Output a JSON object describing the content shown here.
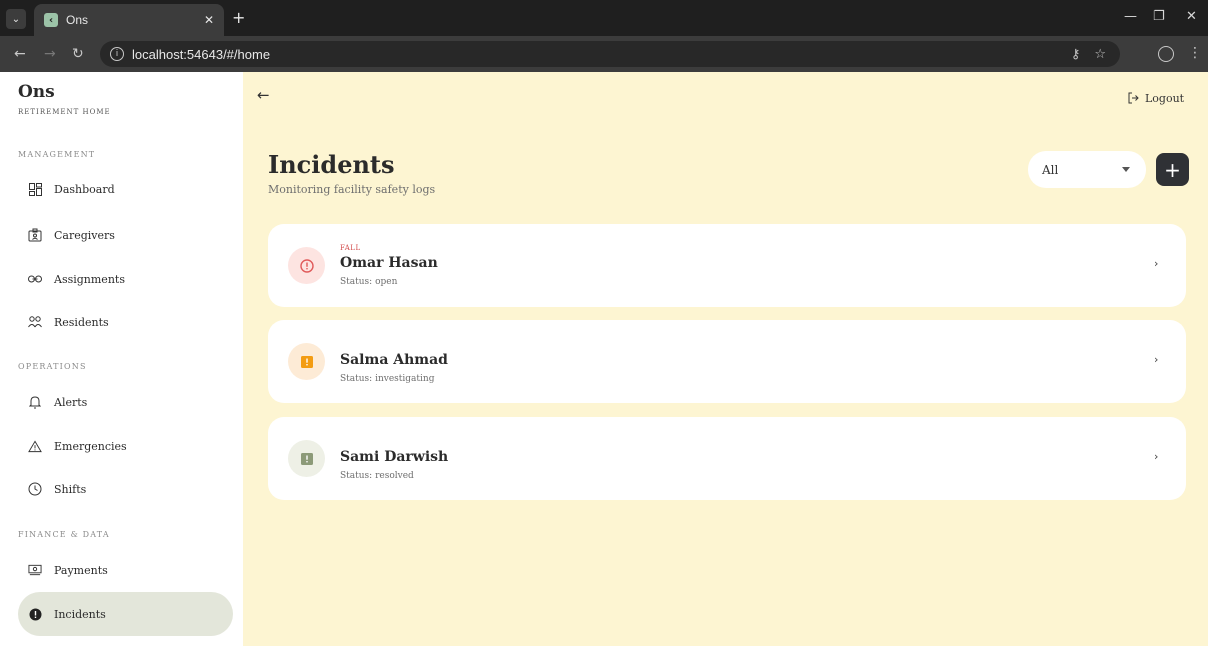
{
  "browser": {
    "tab_title": "Ons",
    "url": "localhost:54643/#/home"
  },
  "sidebar": {
    "brand": "Ons",
    "brand_sub": "RETIREMENT HOME",
    "sections": {
      "management": "MANAGEMENT",
      "operations": "OPERATIONS",
      "finance": "FINANCE & DATA"
    },
    "items": {
      "dashboard": "Dashboard",
      "caregivers": "Caregivers",
      "assignments": "Assignments",
      "residents": "Residents",
      "alerts": "Alerts",
      "emergencies": "Emergencies",
      "shifts": "Shifts",
      "payments": "Payments",
      "incidents": "Incidents"
    }
  },
  "header": {
    "logout": "Logout"
  },
  "page": {
    "title": "Incidents",
    "subtitle": "Monitoring facility safety logs",
    "filter_value": "All"
  },
  "incidents": [
    {
      "type": "FALL",
      "name": "Omar Hasan",
      "status": "Status: open",
      "color": "#e05a5a"
    },
    {
      "type": "",
      "name": "Salma Ahmad",
      "status": "Status: investigating",
      "color": "#f39c12"
    },
    {
      "type": "",
      "name": "Sami Darwish",
      "status": "Status: resolved",
      "color": "#8c9a78"
    }
  ]
}
